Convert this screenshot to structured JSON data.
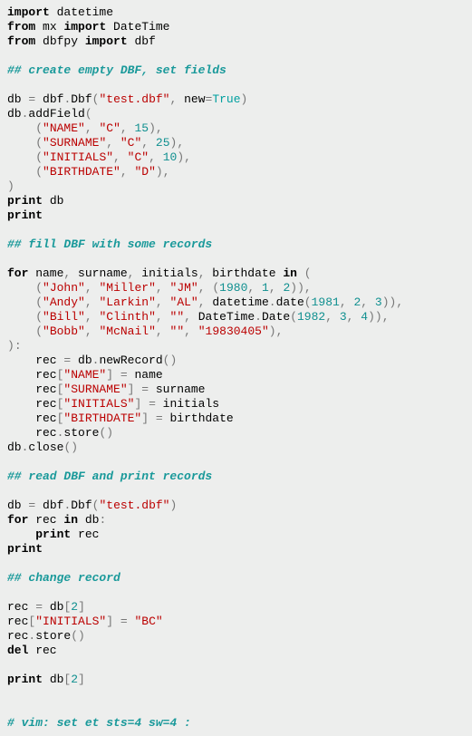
{
  "lines": [
    [
      [
        "kw",
        "import"
      ],
      [
        "n",
        " datetime"
      ]
    ],
    [
      [
        "kw",
        "from"
      ],
      [
        "n",
        " mx "
      ],
      [
        "kw",
        "import"
      ],
      [
        "n",
        " DateTime"
      ]
    ],
    [
      [
        "kw",
        "from"
      ],
      [
        "n",
        " dbfpy "
      ],
      [
        "kw",
        "import"
      ],
      [
        "n",
        " dbf"
      ]
    ],
    [],
    [
      [
        "c",
        "## create empty DBF, set fields"
      ]
    ],
    [],
    [
      [
        "n",
        "db "
      ],
      [
        "op",
        "="
      ],
      [
        "n",
        " dbf"
      ],
      [
        "op",
        "."
      ],
      [
        "n",
        "Dbf"
      ],
      [
        "br",
        "("
      ],
      [
        "s",
        "\"test.dbf\""
      ],
      [
        "op",
        ","
      ],
      [
        "n",
        " new"
      ],
      [
        "op",
        "="
      ],
      [
        "bi",
        "True"
      ],
      [
        "br",
        ")"
      ]
    ],
    [
      [
        "n",
        "db"
      ],
      [
        "op",
        "."
      ],
      [
        "n",
        "addField"
      ],
      [
        "br",
        "("
      ]
    ],
    [
      [
        "n",
        "    "
      ],
      [
        "br",
        "("
      ],
      [
        "s",
        "\"NAME\""
      ],
      [
        "op",
        ","
      ],
      [
        "n",
        " "
      ],
      [
        "s",
        "\"C\""
      ],
      [
        "op",
        ","
      ],
      [
        "n",
        " "
      ],
      [
        "num",
        "15"
      ],
      [
        "br",
        ")"
      ],
      [
        "op",
        ","
      ]
    ],
    [
      [
        "n",
        "    "
      ],
      [
        "br",
        "("
      ],
      [
        "s",
        "\"SURNAME\""
      ],
      [
        "op",
        ","
      ],
      [
        "n",
        " "
      ],
      [
        "s",
        "\"C\""
      ],
      [
        "op",
        ","
      ],
      [
        "n",
        " "
      ],
      [
        "num",
        "25"
      ],
      [
        "br",
        ")"
      ],
      [
        "op",
        ","
      ]
    ],
    [
      [
        "n",
        "    "
      ],
      [
        "br",
        "("
      ],
      [
        "s",
        "\"INITIALS\""
      ],
      [
        "op",
        ","
      ],
      [
        "n",
        " "
      ],
      [
        "s",
        "\"C\""
      ],
      [
        "op",
        ","
      ],
      [
        "n",
        " "
      ],
      [
        "num",
        "10"
      ],
      [
        "br",
        ")"
      ],
      [
        "op",
        ","
      ]
    ],
    [
      [
        "n",
        "    "
      ],
      [
        "br",
        "("
      ],
      [
        "s",
        "\"BIRTHDATE\""
      ],
      [
        "op",
        ","
      ],
      [
        "n",
        " "
      ],
      [
        "s",
        "\"D\""
      ],
      [
        "br",
        ")"
      ],
      [
        "op",
        ","
      ]
    ],
    [
      [
        "br",
        ")"
      ]
    ],
    [
      [
        "kw",
        "print"
      ],
      [
        "n",
        " db"
      ]
    ],
    [
      [
        "kw",
        "print"
      ]
    ],
    [],
    [
      [
        "c",
        "## fill DBF with some records"
      ]
    ],
    [],
    [
      [
        "kw",
        "for"
      ],
      [
        "n",
        " name"
      ],
      [
        "op",
        ","
      ],
      [
        "n",
        " surname"
      ],
      [
        "op",
        ","
      ],
      [
        "n",
        " initials"
      ],
      [
        "op",
        ","
      ],
      [
        "n",
        " birthdate "
      ],
      [
        "kw",
        "in"
      ],
      [
        "n",
        " "
      ],
      [
        "br",
        "("
      ]
    ],
    [
      [
        "n",
        "    "
      ],
      [
        "br",
        "("
      ],
      [
        "s",
        "\"John\""
      ],
      [
        "op",
        ","
      ],
      [
        "n",
        " "
      ],
      [
        "s",
        "\"Miller\""
      ],
      [
        "op",
        ","
      ],
      [
        "n",
        " "
      ],
      [
        "s",
        "\"JM\""
      ],
      [
        "op",
        ","
      ],
      [
        "n",
        " "
      ],
      [
        "br",
        "("
      ],
      [
        "num",
        "1980"
      ],
      [
        "op",
        ","
      ],
      [
        "n",
        " "
      ],
      [
        "num",
        "1"
      ],
      [
        "op",
        ","
      ],
      [
        "n",
        " "
      ],
      [
        "num",
        "2"
      ],
      [
        "br",
        "))"
      ],
      [
        "op",
        ","
      ]
    ],
    [
      [
        "n",
        "    "
      ],
      [
        "br",
        "("
      ],
      [
        "s",
        "\"Andy\""
      ],
      [
        "op",
        ","
      ],
      [
        "n",
        " "
      ],
      [
        "s",
        "\"Larkin\""
      ],
      [
        "op",
        ","
      ],
      [
        "n",
        " "
      ],
      [
        "s",
        "\"AL\""
      ],
      [
        "op",
        ","
      ],
      [
        "n",
        " datetime"
      ],
      [
        "op",
        "."
      ],
      [
        "n",
        "date"
      ],
      [
        "br",
        "("
      ],
      [
        "num",
        "1981"
      ],
      [
        "op",
        ","
      ],
      [
        "n",
        " "
      ],
      [
        "num",
        "2"
      ],
      [
        "op",
        ","
      ],
      [
        "n",
        " "
      ],
      [
        "num",
        "3"
      ],
      [
        "br",
        "))"
      ],
      [
        "op",
        ","
      ]
    ],
    [
      [
        "n",
        "    "
      ],
      [
        "br",
        "("
      ],
      [
        "s",
        "\"Bill\""
      ],
      [
        "op",
        ","
      ],
      [
        "n",
        " "
      ],
      [
        "s",
        "\"Clinth\""
      ],
      [
        "op",
        ","
      ],
      [
        "n",
        " "
      ],
      [
        "s",
        "\"\""
      ],
      [
        "op",
        ","
      ],
      [
        "n",
        " DateTime"
      ],
      [
        "op",
        "."
      ],
      [
        "n",
        "Date"
      ],
      [
        "br",
        "("
      ],
      [
        "num",
        "1982"
      ],
      [
        "op",
        ","
      ],
      [
        "n",
        " "
      ],
      [
        "num",
        "3"
      ],
      [
        "op",
        ","
      ],
      [
        "n",
        " "
      ],
      [
        "num",
        "4"
      ],
      [
        "br",
        "))"
      ],
      [
        "op",
        ","
      ]
    ],
    [
      [
        "n",
        "    "
      ],
      [
        "br",
        "("
      ],
      [
        "s",
        "\"Bobb\""
      ],
      [
        "op",
        ","
      ],
      [
        "n",
        " "
      ],
      [
        "s",
        "\"McNail\""
      ],
      [
        "op",
        ","
      ],
      [
        "n",
        " "
      ],
      [
        "s",
        "\"\""
      ],
      [
        "op",
        ","
      ],
      [
        "n",
        " "
      ],
      [
        "s",
        "\"19830405\""
      ],
      [
        "br",
        ")"
      ],
      [
        "op",
        ","
      ]
    ],
    [
      [
        "br",
        ")"
      ],
      [
        "op",
        ":"
      ]
    ],
    [
      [
        "n",
        "    rec "
      ],
      [
        "op",
        "="
      ],
      [
        "n",
        " db"
      ],
      [
        "op",
        "."
      ],
      [
        "n",
        "newRecord"
      ],
      [
        "br",
        "()"
      ]
    ],
    [
      [
        "n",
        "    rec"
      ],
      [
        "br",
        "["
      ],
      [
        "s",
        "\"NAME\""
      ],
      [
        "br",
        "]"
      ],
      [
        "n",
        " "
      ],
      [
        "op",
        "="
      ],
      [
        "n",
        " name"
      ]
    ],
    [
      [
        "n",
        "    rec"
      ],
      [
        "br",
        "["
      ],
      [
        "s",
        "\"SURNAME\""
      ],
      [
        "br",
        "]"
      ],
      [
        "n",
        " "
      ],
      [
        "op",
        "="
      ],
      [
        "n",
        " surname"
      ]
    ],
    [
      [
        "n",
        "    rec"
      ],
      [
        "br",
        "["
      ],
      [
        "s",
        "\"INITIALS\""
      ],
      [
        "br",
        "]"
      ],
      [
        "n",
        " "
      ],
      [
        "op",
        "="
      ],
      [
        "n",
        " initials"
      ]
    ],
    [
      [
        "n",
        "    rec"
      ],
      [
        "br",
        "["
      ],
      [
        "s",
        "\"BIRTHDATE\""
      ],
      [
        "br",
        "]"
      ],
      [
        "n",
        " "
      ],
      [
        "op",
        "="
      ],
      [
        "n",
        " birthdate"
      ]
    ],
    [
      [
        "n",
        "    rec"
      ],
      [
        "op",
        "."
      ],
      [
        "n",
        "store"
      ],
      [
        "br",
        "()"
      ]
    ],
    [
      [
        "n",
        "db"
      ],
      [
        "op",
        "."
      ],
      [
        "n",
        "close"
      ],
      [
        "br",
        "()"
      ]
    ],
    [],
    [
      [
        "c",
        "## read DBF and print records"
      ]
    ],
    [],
    [
      [
        "n",
        "db "
      ],
      [
        "op",
        "="
      ],
      [
        "n",
        " dbf"
      ],
      [
        "op",
        "."
      ],
      [
        "n",
        "Dbf"
      ],
      [
        "br",
        "("
      ],
      [
        "s",
        "\"test.dbf\""
      ],
      [
        "br",
        ")"
      ]
    ],
    [
      [
        "kw",
        "for"
      ],
      [
        "n",
        " rec "
      ],
      [
        "kw",
        "in"
      ],
      [
        "n",
        " db"
      ],
      [
        "op",
        ":"
      ]
    ],
    [
      [
        "n",
        "    "
      ],
      [
        "kw",
        "print"
      ],
      [
        "n",
        " rec"
      ]
    ],
    [
      [
        "kw",
        "print"
      ]
    ],
    [],
    [
      [
        "c",
        "## change record"
      ]
    ],
    [],
    [
      [
        "n",
        "rec "
      ],
      [
        "op",
        "="
      ],
      [
        "n",
        " db"
      ],
      [
        "br",
        "["
      ],
      [
        "num",
        "2"
      ],
      [
        "br",
        "]"
      ]
    ],
    [
      [
        "n",
        "rec"
      ],
      [
        "br",
        "["
      ],
      [
        "s",
        "\"INITIALS\""
      ],
      [
        "br",
        "]"
      ],
      [
        "n",
        " "
      ],
      [
        "op",
        "="
      ],
      [
        "n",
        " "
      ],
      [
        "s",
        "\"BC\""
      ]
    ],
    [
      [
        "n",
        "rec"
      ],
      [
        "op",
        "."
      ],
      [
        "n",
        "store"
      ],
      [
        "br",
        "()"
      ]
    ],
    [
      [
        "kw",
        "del"
      ],
      [
        "n",
        " rec"
      ]
    ],
    [],
    [
      [
        "kw",
        "print"
      ],
      [
        "n",
        " db"
      ],
      [
        "br",
        "["
      ],
      [
        "num",
        "2"
      ],
      [
        "br",
        "]"
      ]
    ],
    [],
    [],
    [
      [
        "c",
        "# vim: set et sts=4 sw=4 :"
      ]
    ]
  ]
}
